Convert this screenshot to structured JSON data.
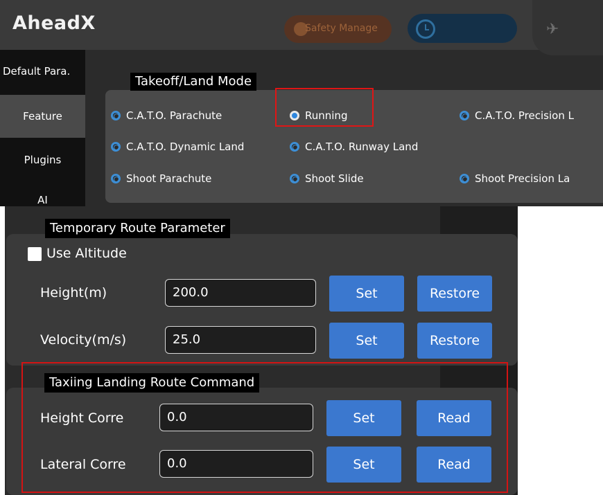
{
  "header": {
    "app_name": "AheadX",
    "safety_button": "Safety Manage",
    "icons": [
      "clock-icon",
      "airplane-icon"
    ]
  },
  "sidebar": {
    "items": [
      {
        "label": "Default Para.",
        "active": false
      },
      {
        "label": "Feature",
        "active": true
      },
      {
        "label": "Plugins",
        "active": false
      },
      {
        "label": "AI",
        "active": false
      }
    ]
  },
  "takeoff_land_mode": {
    "title": "Takeoff/Land Mode",
    "options": [
      {
        "label": "C.A.T.O. Parachute",
        "selected": false
      },
      {
        "label": "Running",
        "selected": true
      },
      {
        "label": "C.A.T.O. Precision L",
        "selected": false
      },
      {
        "label": "C.A.T.O. Dynamic Land",
        "selected": false
      },
      {
        "label": "C.A.T.O. Runway Land",
        "selected": false
      },
      {
        "label": "Shoot Parachute",
        "selected": false
      },
      {
        "label": "Shoot Slide",
        "selected": false
      },
      {
        "label": "Shoot Precision La",
        "selected": false
      }
    ]
  },
  "temporary_route": {
    "title": "Temporary Route Parameter",
    "use_altitude_label": "Use Altitude",
    "use_altitude_checked": false,
    "height_label": "Height(m)",
    "height_value": "200.0",
    "velocity_label": "Velocity(m/s)",
    "velocity_value": "25.0",
    "set_label": "Set",
    "restore_label": "Restore"
  },
  "taxiing_landing": {
    "title": "Taxiing Landing Route Command",
    "height_corr_label": "Height Corre",
    "height_corr_value": "0.0",
    "lateral_corr_label": "Lateral Corre",
    "lateral_corr_value": "0.0",
    "set_label": "Set",
    "read_label": "Read"
  },
  "colors": {
    "accent": "#3b78cf",
    "radio": "#3d8fd6",
    "highlight": "#e01515",
    "panel": "#3a3a3a",
    "background": "#2b2b2b"
  }
}
